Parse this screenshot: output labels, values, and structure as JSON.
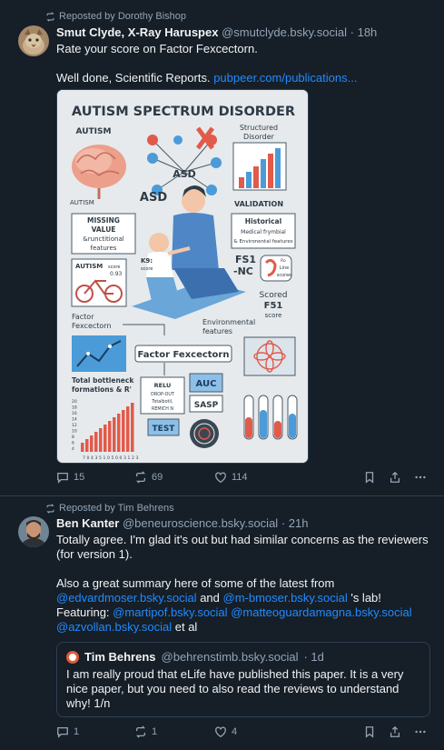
{
  "post1": {
    "repost_label": "Reposted by Dorothy Bishop",
    "author_name": "Smut Clyde, X-Ray Haruspex",
    "author_handle": "@smutclyde.bsky.social",
    "time": "· 18h",
    "text_line1": "Rate your score on Factor Fexcectorn.",
    "text_line2": "Well done, Scientific Reports.",
    "link": "pubpeer.com/publications...",
    "infographic": {
      "title": "AUTISM SPECTRUM DISORDER",
      "autism_top": "AUTISM",
      "structured": "Structured",
      "disorder": "Disorder",
      "asd_small": "ASD",
      "asd_big": "ASD",
      "autism_small": "AUTISM",
      "validation": "VALIDATION",
      "missing_value_lines": [
        "MISSING",
        "VALUE",
        "&runctitional",
        "features"
      ],
      "historical_lines": [
        "Historical",
        "Medical frymbial",
        "& Environental features"
      ],
      "autism_score": "AUTISM",
      "score_small": "score",
      "score_val": "0.93",
      "k9": "K9:",
      "score_k9": "score",
      "fs1_nc": [
        "FS1",
        "-NC"
      ],
      "kol_lines": [
        "Ro",
        "Line",
        "scoree"
      ],
      "scored_lines": [
        "Scored",
        "F51",
        "score"
      ],
      "factor_label_lines": [
        "Factor",
        "Fexcectorn"
      ],
      "env_lines": [
        "Environmental",
        "features"
      ],
      "factor_main": "Factor Fexcectorn",
      "total_lines": [
        "Total bottleneck",
        "formations & R'"
      ],
      "relu_lines": [
        "RELU",
        "DROP-OUT",
        "Totalbotil,",
        "REMICH N"
      ],
      "auc": "AUC",
      "sasp": "SASP",
      "test": "TEST",
      "bar_ticks": [
        "7",
        "0",
        "4",
        "3",
        "5",
        "1",
        "0",
        "5",
        "0",
        "0",
        "3",
        "1",
        "2",
        "3"
      ],
      "y_ticks": [
        "20",
        "18",
        "16",
        "14",
        "12",
        "10",
        "8",
        "6",
        "4"
      ]
    },
    "replies": "15",
    "reposts": "69",
    "likes": "114"
  },
  "post2": {
    "repost_label": "Reposted by Tim Behrens",
    "author_name": "Ben Kanter",
    "author_handle": "@beneuroscience.bsky.social",
    "time": "· 21h",
    "para1": "Totally agree. I'm glad it's out but had similar concerns as the reviewers (for version 1).",
    "para2_start": "Also a great summary here of some of the latest from",
    "mention1": "@edvardmoser.bsky.social",
    "and": " and ",
    "mention2": "@m-bmoser.bsky.social",
    "lab": " 's lab! Featuring:",
    "mention3": "@martipof.bsky.social",
    "mention4": "@matteoguardamagna.bsky.social",
    "mention5": "@azvollan.bsky.social",
    "et_al": " et al",
    "quote": {
      "author_name": "Tim Behrens",
      "author_handle": "@behrenstimb.bsky.social",
      "time": "· 1d",
      "text": "I am really proud that eLife have published this paper.  It is a very nice paper,  but you need to also read the reviews to understand why! 1/n"
    },
    "replies": "1",
    "reposts": "1",
    "likes": "4"
  },
  "colors": {
    "background": "#161e27",
    "accent_link": "#208bfe",
    "muted": "#93a5b7",
    "divider": "#2e4052"
  }
}
